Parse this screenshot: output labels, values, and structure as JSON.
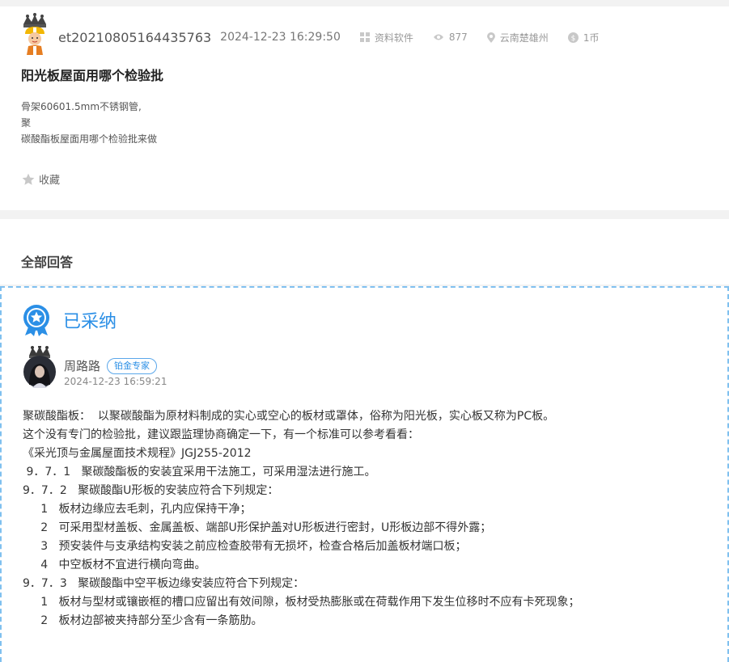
{
  "question": {
    "username": "et20210805164435763",
    "time": "2024-12-23 16:29:50",
    "category": "资料软件",
    "views": "877",
    "location": "云南楚雄州",
    "reward": "1币",
    "title": "阳光板屋面用哪个检验批",
    "body_lines": [
      "骨架60601.5mm不锈钢管,",
      "聚",
      "碳酸酯板屋面用哪个检验批来做"
    ],
    "favorite_label": "收藏"
  },
  "answers_section": {
    "title": "全部回答"
  },
  "answer": {
    "adopted_label": "已采纳",
    "username": "周路路",
    "badge": "铂金专家",
    "time": "2024-12-23 16:59:21",
    "lines": [
      "聚碳酸酯板：  以聚碳酸酯为原材料制成的实心或空心的板材或罩体，俗称为阳光板，实心板又称为PC板。",
      "这个没有专门的检验批，建议跟监理协商确定一下，有一个标准可以参考看看：",
      "《采光顶与金属屋面技术规程》JGJ255-2012",
      " 9．7．1   聚碳酸酯板的安装宜采用干法施工，可采用湿法进行施工。",
      "9．7．2   聚碳酸酯U形板的安装应符合下列规定：",
      "     1   板材边缘应去毛刺，孔内应保持干净；",
      "     2   可采用型材盖板、金属盖板、端部U形保护盖对U形板进行密封，U形板边部不得外露；",
      "     3   预安装件与支承结构安装之前应检查胶带有无损坏，检查合格后加盖板材端口板；",
      "     4   中空板材不宜进行横向弯曲。",
      "9．7．3   聚碳酸酯中空平板边缘安装应符合下列规定：",
      "     1   板材与型材或镶嵌框的槽口应留出有效间隙，板材受热膨胀或在荷载作用下发生位移时不应有卡死现象；",
      "     2   板材边部被夹持部分至少含有一条筋肋。"
    ]
  },
  "icons": {
    "category": "grid-icon",
    "views": "eye-icon",
    "location": "location-pin-icon",
    "reward": "coin-icon",
    "favorite": "star-icon",
    "adopted": "medal-icon"
  },
  "colors": {
    "accent": "#2b8fe6",
    "dashed_border": "#7fc0ef",
    "background": "#f2f2f2"
  }
}
